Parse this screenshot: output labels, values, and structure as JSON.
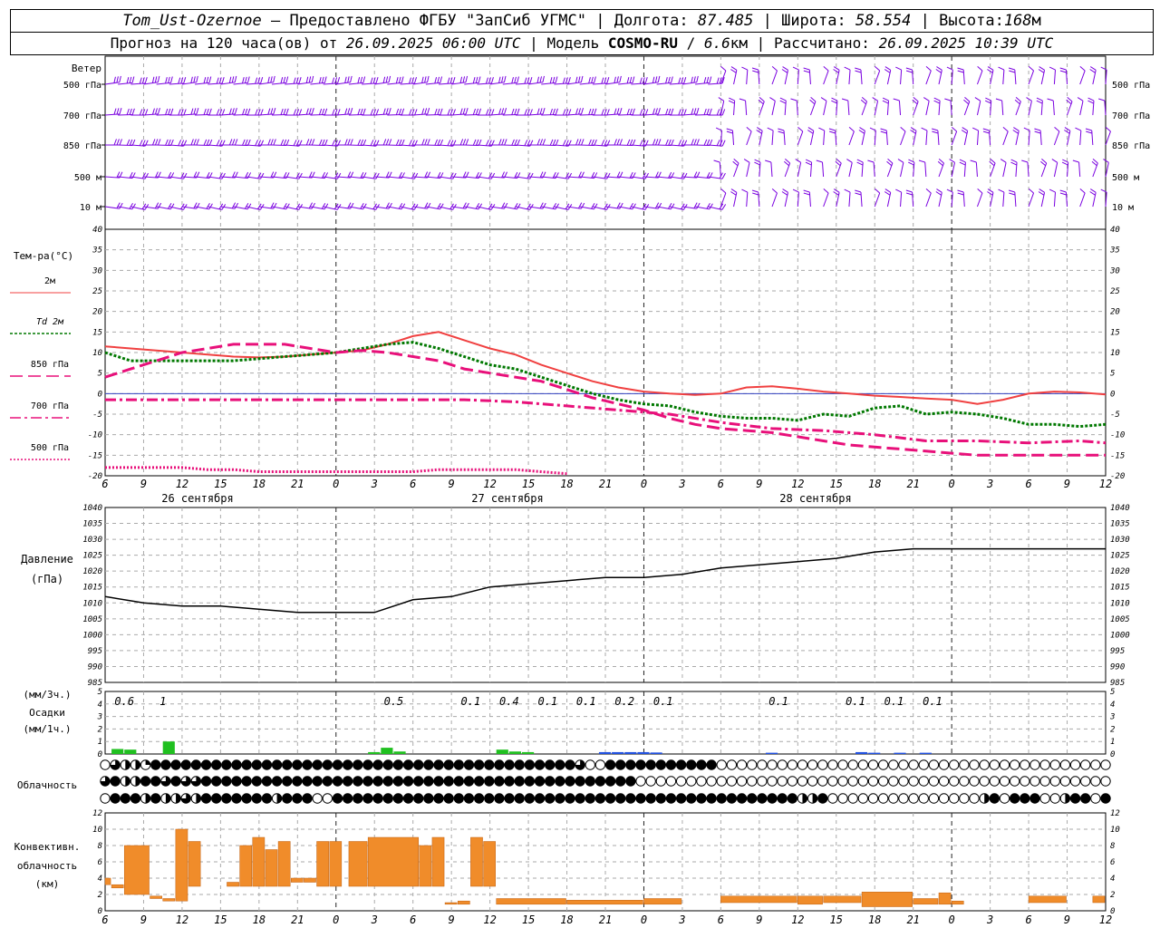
{
  "header": {
    "station": "Tom_Ust-Ozernoe",
    "dash": "–",
    "provider": "Предоставлено ФГБУ \"ЗапСиб УГМС\"",
    "lon_label": "Долгота:",
    "lon": "87.485",
    "lat_label": "Широта:",
    "lat": "58.554",
    "alt_label": "Высота:",
    "alt": "168",
    "alt_unit": "м",
    "fc_prefix": "Прогноз на 120 часа(ов) от",
    "fc_date": "26.09.2025 06:00 UTC",
    "model_label": "Модель",
    "model_name": "COSMO-RU",
    "model_res": "6.6",
    "model_res_unit": "км",
    "calc_label": "Рассчитано:",
    "calc_date": "26.09.2025 10:39 UTC",
    "sep": "|"
  },
  "chart_data": [
    {
      "type": "barbs",
      "panel": "wind",
      "title": "Ветер",
      "levels": [
        "500 гПа",
        "700 гПа",
        "850 гПа",
        "500 м",
        "10  м"
      ],
      "colors": {
        "barb": "#7a00e0"
      }
    },
    {
      "type": "line",
      "panel": "temperature",
      "ylabel": "Тем-ра(°С)",
      "ylim": [
        -20,
        40
      ],
      "yticks": [
        -20,
        -15,
        -10,
        -5,
        0,
        5,
        10,
        15,
        20,
        25,
        30,
        35,
        40
      ],
      "x_hours": [
        0,
        3,
        6,
        9,
        12,
        15,
        18,
        21,
        24,
        27,
        30,
        33,
        36,
        39,
        42,
        45,
        48,
        51,
        54,
        57,
        60,
        63,
        66,
        69,
        72,
        75,
        78
      ],
      "x_tick_labels": [
        "6",
        "9",
        "12",
        "15",
        "18",
        "21",
        "0",
        "3",
        "6",
        "9",
        "12",
        "15",
        "18",
        "21",
        "0",
        "3",
        "6",
        "9",
        "12",
        "15",
        "18",
        "21",
        "0",
        "3",
        "6",
        "9",
        "12"
      ],
      "day_labels": [
        "26 сентября",
        "27 сентября",
        "28 сентября"
      ],
      "series": [
        {
          "name": "2м",
          "color": "#f04040",
          "x": [
            0,
            2,
            4,
            6,
            8,
            10,
            12,
            14,
            16,
            18,
            20,
            22,
            24,
            26,
            28,
            30,
            32,
            34,
            36,
            38,
            40,
            42,
            44,
            46,
            48,
            50,
            52,
            54,
            56,
            58,
            60,
            62,
            64,
            66,
            68,
            70,
            72,
            74,
            76,
            78
          ],
          "values": [
            11.5,
            11,
            10.5,
            10,
            9.5,
            9,
            8.8,
            9,
            9.5,
            10,
            10.5,
            12,
            14,
            15,
            13,
            11,
            9.5,
            7,
            5,
            3,
            1.5,
            0.5,
            0,
            -0.3,
            0,
            1.5,
            1.8,
            1.2,
            0.5,
            0,
            -0.5,
            -0.8,
            -1.2,
            -1.5,
            -2.5,
            -1.5,
            0,
            0.5,
            0.3,
            -0.2
          ]
        },
        {
          "name": "Td  2м",
          "color": "#007800",
          "x": [
            0,
            2,
            4,
            6,
            8,
            10,
            12,
            14,
            16,
            18,
            20,
            22,
            24,
            26,
            28,
            30,
            32,
            34,
            36,
            38,
            40,
            42,
            44,
            46,
            48,
            50,
            52,
            54,
            56,
            58,
            60,
            62,
            64,
            66,
            68,
            70,
            72,
            74,
            76,
            78
          ],
          "values": [
            10,
            8,
            8,
            8,
            8,
            8,
            8.5,
            9,
            9.5,
            10,
            11,
            12,
            12.5,
            11,
            9,
            7,
            6,
            4,
            2,
            0,
            -1.5,
            -2.5,
            -3,
            -4.5,
            -5.5,
            -6,
            -6,
            -6.5,
            -5,
            -5.5,
            -3.5,
            -3,
            -5,
            -4.5,
            -5,
            -6,
            -7.5,
            -7.5,
            -8,
            -7.5
          ]
        },
        {
          "name": "850 гПа",
          "color": "#e8107a",
          "dash": "long",
          "x": [
            0,
            2,
            4,
            6,
            8,
            10,
            12,
            14,
            16,
            18,
            20,
            22,
            24,
            26,
            28,
            30,
            32,
            34,
            36,
            38,
            40,
            42,
            44,
            46,
            48,
            50,
            52,
            54,
            56,
            58,
            60,
            62,
            64,
            66,
            68,
            70,
            72,
            74,
            76,
            78
          ],
          "values": [
            4,
            6,
            8,
            10,
            11,
            12,
            12,
            12,
            11,
            10,
            10.5,
            10,
            9,
            8,
            6,
            5,
            4,
            3,
            1,
            -1,
            -2.5,
            -4,
            -6,
            -7.5,
            -8.5,
            -9,
            -9.5,
            -10.5,
            -11.5,
            -12.5,
            -13,
            -13.5,
            -14,
            -14.5,
            -15,
            -15,
            -15,
            -15,
            -15,
            -15
          ]
        },
        {
          "name": "700 гПа",
          "color": "#e8107a",
          "dash": "dashdot",
          "x": [
            0,
            4,
            8,
            12,
            16,
            20,
            24,
            28,
            32,
            36,
            40,
            44,
            48,
            52,
            56,
            60,
            64,
            68,
            72,
            76,
            78
          ],
          "values": [
            -1.5,
            -1.5,
            -1.5,
            -1.5,
            -1.5,
            -1.5,
            -1.5,
            -1.5,
            -2,
            -3,
            -4,
            -5,
            -7,
            -8.5,
            -9,
            -10,
            -11.5,
            -11.5,
            -12,
            -11.5,
            -12
          ]
        },
        {
          "name": "500 гПа",
          "color": "#e8107a",
          "dash": "dot",
          "x": [
            0,
            2,
            4,
            6,
            8,
            10,
            12,
            14,
            16,
            18,
            20,
            22,
            24,
            26,
            28,
            30,
            32,
            34,
            36
          ],
          "values": [
            -18,
            -18,
            -18,
            -18,
            -18.5,
            -18.5,
            -19,
            -19,
            -19,
            -19,
            -19,
            -19,
            -19,
            -18.5,
            -18.5,
            -18.5,
            -18.5,
            -19,
            -19.5
          ]
        }
      ]
    },
    {
      "type": "line",
      "panel": "pressure",
      "ylabel": "Давление",
      "yunit": "(гПа)",
      "ylim": [
        985,
        1040
      ],
      "yticks": [
        985,
        990,
        995,
        1000,
        1005,
        1010,
        1015,
        1020,
        1025,
        1030,
        1035,
        1040
      ],
      "series": [
        {
          "name": "",
          "color": "#000000",
          "x": [
            0,
            3,
            6,
            9,
            12,
            15,
            18,
            21,
            24,
            27,
            30,
            33,
            36,
            39,
            42,
            45,
            48,
            51,
            54,
            57,
            60,
            63,
            66,
            69,
            72,
            75,
            78
          ],
          "values": [
            1012,
            1010,
            1009,
            1009,
            1008,
            1007,
            1007,
            1007,
            1011,
            1012,
            1015,
            1016,
            1017,
            1018,
            1018,
            1019,
            1021,
            1022,
            1023,
            1024,
            1026,
            1027,
            1027,
            1027,
            1027,
            1027,
            1027
          ]
        }
      ]
    },
    {
      "type": "bar",
      "panel": "precipitation",
      "ylabel_top": "(мм/3ч.)",
      "ylabel_mid": "Осадки",
      "ylabel_bottom": "(мм/1ч.)",
      "ylim": [
        0,
        5
      ],
      "yticks": [
        0,
        1,
        2,
        3,
        4,
        5
      ],
      "labels": [
        {
          "hour": 1.5,
          "text": "0.6"
        },
        {
          "hour": 4.5,
          "text": "1"
        },
        {
          "hour": 22.5,
          "text": "0.5"
        },
        {
          "hour": 28.5,
          "text": "0.1"
        },
        {
          "hour": 31.5,
          "text": "0.4"
        },
        {
          "hour": 34.5,
          "text": "0.1"
        },
        {
          "hour": 37.5,
          "text": "0.1"
        },
        {
          "hour": 40.5,
          "text": "0.2"
        },
        {
          "hour": 43.5,
          "text": "0.1"
        },
        {
          "hour": 52.5,
          "text": "0.1"
        },
        {
          "hour": 58.5,
          "text": "0.1"
        },
        {
          "hour": 61.5,
          "text": "0.1"
        },
        {
          "hour": 64.5,
          "text": "0.1"
        }
      ],
      "bars": [
        {
          "hour": 1,
          "value": 0.4,
          "color": "#20c020"
        },
        {
          "hour": 2,
          "value": 0.35,
          "color": "#20c020"
        },
        {
          "hour": 5,
          "value": 1.0,
          "color": "#20c020"
        },
        {
          "hour": 21,
          "value": 0.15,
          "color": "#20c020"
        },
        {
          "hour": 22,
          "value": 0.5,
          "color": "#20c020"
        },
        {
          "hour": 23,
          "value": 0.2,
          "color": "#20c020"
        },
        {
          "hour": 31,
          "value": 0.35,
          "color": "#20c020"
        },
        {
          "hour": 32,
          "value": 0.2,
          "color": "#20c020"
        },
        {
          "hour": 33,
          "value": 0.15,
          "color": "#20c020"
        },
        {
          "hour": 39,
          "value": 0.15,
          "color": "#2050e0"
        },
        {
          "hour": 40,
          "value": 0.15,
          "color": "#2050e0"
        },
        {
          "hour": 41,
          "value": 0.15,
          "color": "#2050e0"
        },
        {
          "hour": 42,
          "value": 0.15,
          "color": "#2050e0"
        },
        {
          "hour": 43,
          "value": 0.12,
          "color": "#2050e0"
        },
        {
          "hour": 52,
          "value": 0.1,
          "color": "#2050e0"
        },
        {
          "hour": 59,
          "value": 0.15,
          "color": "#2050e0"
        },
        {
          "hour": 60,
          "value": 0.1,
          "color": "#2050e0"
        },
        {
          "hour": 62,
          "value": 0.1,
          "color": "#2050e0"
        },
        {
          "hour": 64,
          "value": 0.1,
          "color": "#2050e0"
        }
      ]
    },
    {
      "type": "symbols",
      "panel": "cloudiness",
      "ylabel": "Облачность",
      "rows": [
        "0322144444444444444444444444444444444444444444430044444444444000000000000000000000000000000000000000",
        "3422443433444444444444444444444444444444444444444444400000000000000000000000000000000000000000000000",
        "0444242232444444424440044444444444444444444444444444444444444444444442240000000000000002404440024404"
      ]
    },
    {
      "type": "bar",
      "panel": "convective",
      "ylabel": "Конвективн.",
      "ylabel2": "облачность",
      "yunit": "(км)",
      "ylim": [
        0,
        12
      ],
      "yticks": [
        0,
        2,
        4,
        6,
        8,
        10,
        12
      ],
      "color": "#f08c2a",
      "bars": [
        {
          "x0": 0,
          "x1": 0.5,
          "lo": 3.2,
          "hi": 4.0
        },
        {
          "x0": 0.5,
          "x1": 1.5,
          "lo": 2.8,
          "hi": 3.2
        },
        {
          "x0": 1.5,
          "x1": 3.5,
          "lo": 2.0,
          "hi": 8.0
        },
        {
          "x0": 3.5,
          "x1": 4.5,
          "lo": 1.5,
          "hi": 1.8
        },
        {
          "x0": 4.5,
          "x1": 5.5,
          "lo": 1.2,
          "hi": 1.5
        },
        {
          "x0": 5.5,
          "x1": 6.5,
          "lo": 1.2,
          "hi": 10.0
        },
        {
          "x0": 6.5,
          "x1": 7.5,
          "lo": 3.0,
          "hi": 8.5
        },
        {
          "x0": 9.5,
          "x1": 10.5,
          "lo": 3.0,
          "hi": 3.5
        },
        {
          "x0": 10.5,
          "x1": 11.5,
          "lo": 3.0,
          "hi": 8.0
        },
        {
          "x0": 11.5,
          "x1": 12.5,
          "lo": 3.0,
          "hi": 9.0
        },
        {
          "x0": 12.5,
          "x1": 13.5,
          "lo": 3.0,
          "hi": 7.5
        },
        {
          "x0": 13.5,
          "x1": 14.5,
          "lo": 3.0,
          "hi": 8.5
        },
        {
          "x0": 14.5,
          "x1": 15.5,
          "lo": 3.5,
          "hi": 4.0
        },
        {
          "x0": 15.5,
          "x1": 16.5,
          "lo": 3.5,
          "hi": 4.0
        },
        {
          "x0": 16.5,
          "x1": 17.5,
          "lo": 3.0,
          "hi": 8.5
        },
        {
          "x0": 17.5,
          "x1": 18.5,
          "lo": 3.0,
          "hi": 8.5
        },
        {
          "x0": 19,
          "x1": 20.5,
          "lo": 3.0,
          "hi": 8.5
        },
        {
          "x0": 20.5,
          "x1": 24.5,
          "lo": 3.0,
          "hi": 9.0
        },
        {
          "x0": 24.5,
          "x1": 25.5,
          "lo": 3.0,
          "hi": 8.0
        },
        {
          "x0": 25.5,
          "x1": 26.5,
          "lo": 3.0,
          "hi": 9.0
        },
        {
          "x0": 26.5,
          "x1": 27.5,
          "lo": 0.8,
          "hi": 1.0
        },
        {
          "x0": 27.5,
          "x1": 28.5,
          "lo": 0.8,
          "hi": 1.2
        },
        {
          "x0": 28.5,
          "x1": 29.5,
          "lo": 3.0,
          "hi": 9.0
        },
        {
          "x0": 29.5,
          "x1": 30.5,
          "lo": 3.0,
          "hi": 8.5
        },
        {
          "x0": 30.5,
          "x1": 36,
          "lo": 0.8,
          "hi": 1.5
        },
        {
          "x0": 36,
          "x1": 42,
          "lo": 0.8,
          "hi": 1.3
        },
        {
          "x0": 42,
          "x1": 45,
          "lo": 0.8,
          "hi": 1.5
        },
        {
          "x0": 48,
          "x1": 54,
          "lo": 1.0,
          "hi": 1.8
        },
        {
          "x0": 54,
          "x1": 56,
          "lo": 0.8,
          "hi": 1.8
        },
        {
          "x0": 56,
          "x1": 59,
          "lo": 1.0,
          "hi": 1.8
        },
        {
          "x0": 59,
          "x1": 63,
          "lo": 0.5,
          "hi": 2.3
        },
        {
          "x0": 63,
          "x1": 65,
          "lo": 0.8,
          "hi": 1.5
        },
        {
          "x0": 65,
          "x1": 66,
          "lo": 0.8,
          "hi": 2.2
        },
        {
          "x0": 66,
          "x1": 67,
          "lo": 0.8,
          "hi": 1.2
        },
        {
          "x0": 72,
          "x1": 75,
          "lo": 1.0,
          "hi": 1.8
        },
        {
          "x0": 77,
          "x1": 78,
          "lo": 1.0,
          "hi": 1.8
        }
      ]
    }
  ]
}
